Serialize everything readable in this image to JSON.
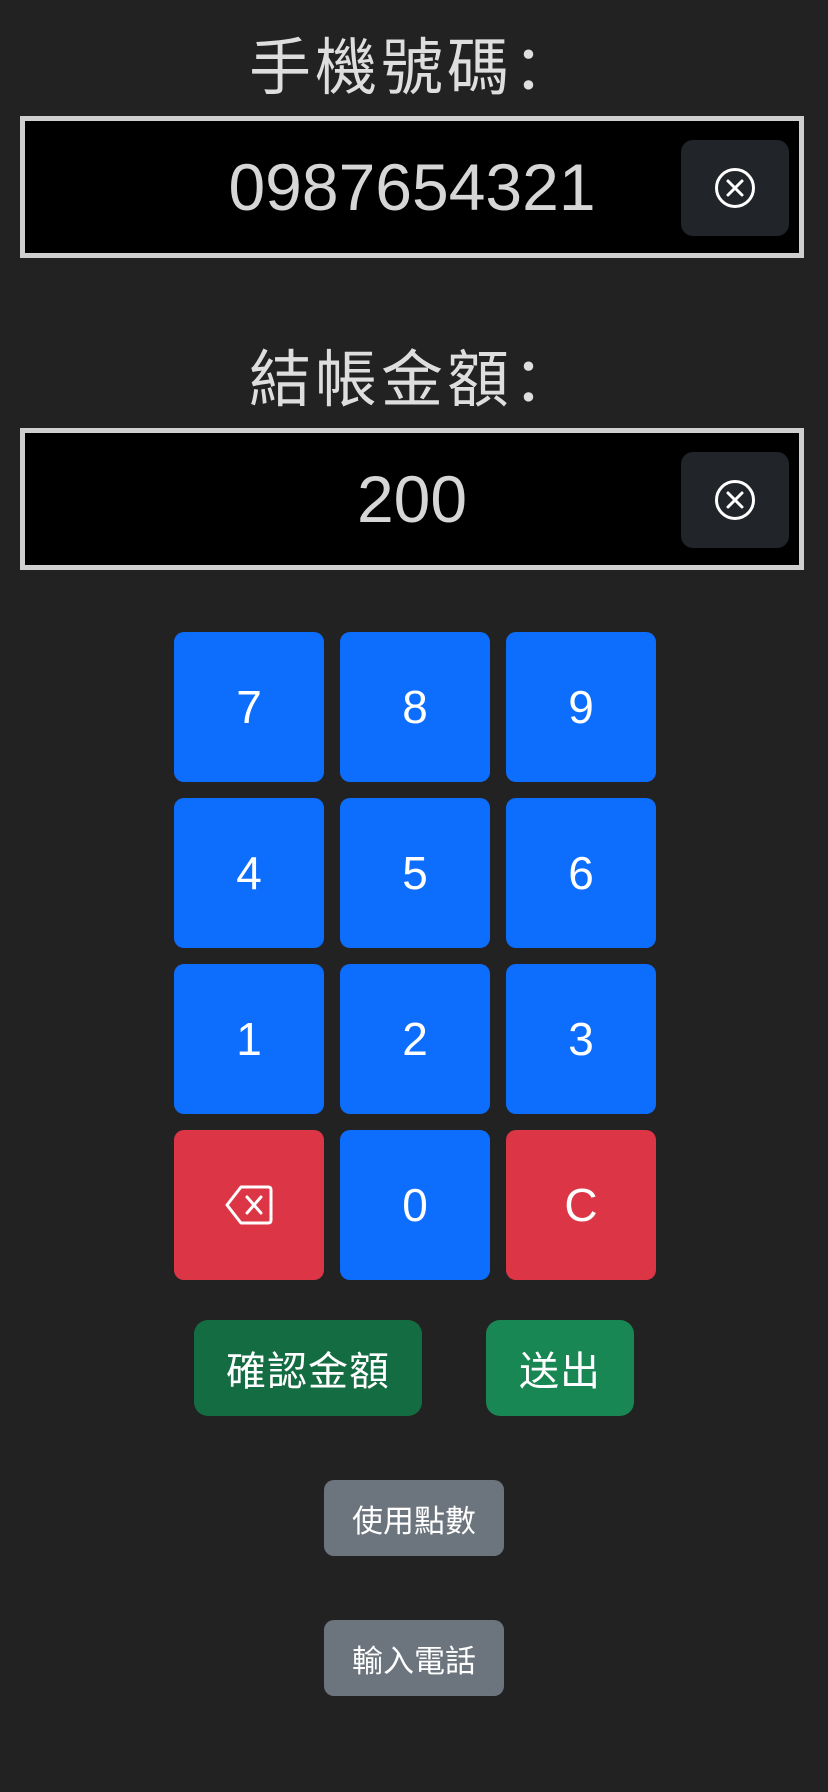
{
  "phone": {
    "label": "手機號碼：",
    "value": "0987654321"
  },
  "amount": {
    "label": "結帳金額：",
    "value": "200"
  },
  "keypad": {
    "k7": "7",
    "k8": "8",
    "k9": "9",
    "k4": "4",
    "k5": "5",
    "k6": "6",
    "k1": "1",
    "k2": "2",
    "k3": "3",
    "k0": "0",
    "clear": "C"
  },
  "actions": {
    "confirm_amount": "確認金額",
    "submit": "送出",
    "use_points": "使用點數",
    "enter_phone": "輸入電話"
  },
  "icons": {
    "field_clear": "x-circle-icon",
    "backspace": "backspace-icon"
  },
  "colors": {
    "background": "#222222",
    "digit_key": "#0d6efd",
    "danger_key": "#dc3545",
    "confirm": "#146c43",
    "submit": "#198754",
    "secondary": "#6c757d"
  }
}
